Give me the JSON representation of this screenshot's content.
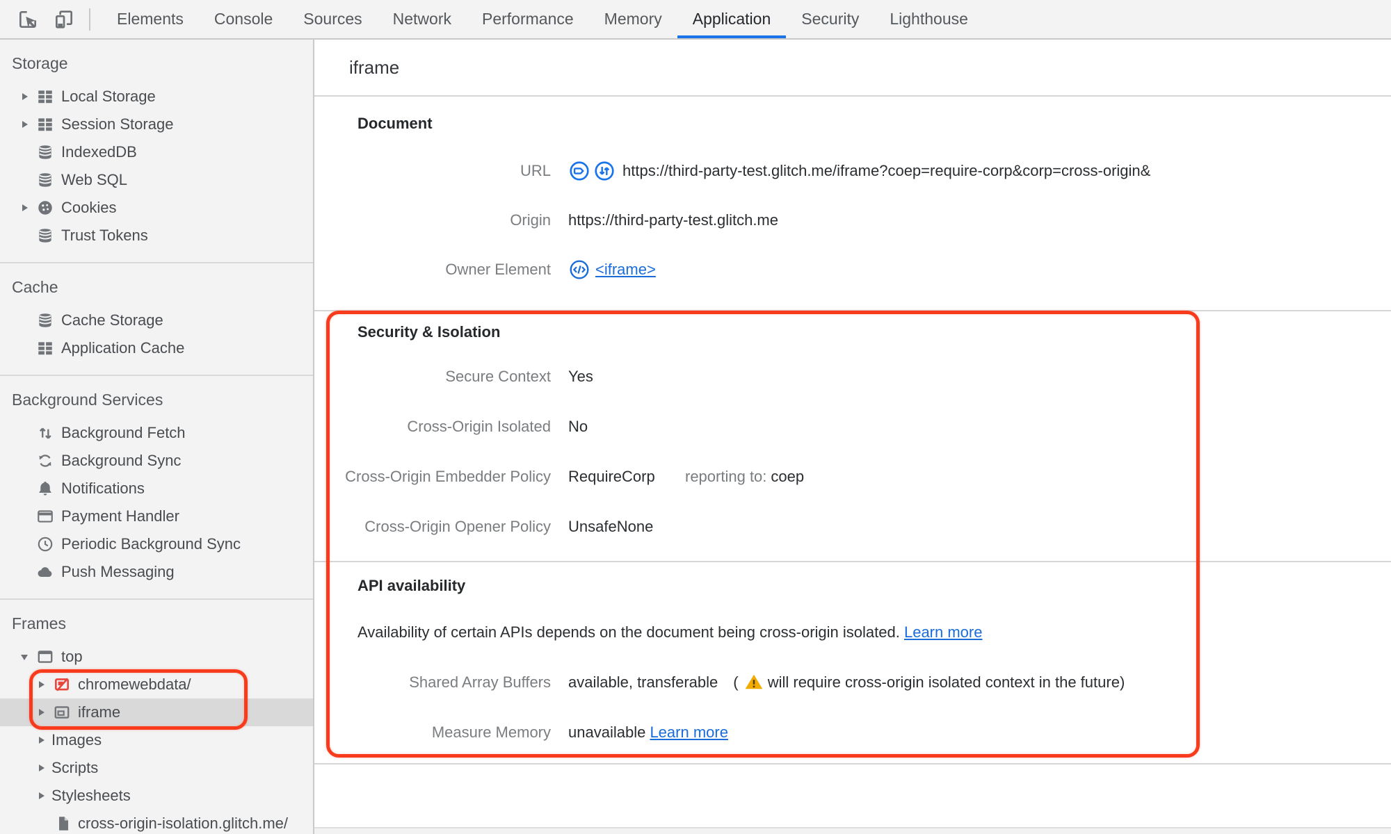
{
  "toolbar": {
    "tabs": [
      {
        "label": "Elements",
        "active": false
      },
      {
        "label": "Console",
        "active": false
      },
      {
        "label": "Sources",
        "active": false
      },
      {
        "label": "Network",
        "active": false
      },
      {
        "label": "Performance",
        "active": false
      },
      {
        "label": "Memory",
        "active": false
      },
      {
        "label": "Application",
        "active": true
      },
      {
        "label": "Security",
        "active": false
      },
      {
        "label": "Lighthouse",
        "active": false
      }
    ]
  },
  "sidebar": {
    "sections": {
      "storage": {
        "title": "Storage",
        "items": [
          "Local Storage",
          "Session Storage",
          "IndexedDB",
          "Web SQL",
          "Cookies",
          "Trust Tokens"
        ]
      },
      "cache": {
        "title": "Cache",
        "items": [
          "Cache Storage",
          "Application Cache"
        ]
      },
      "background": {
        "title": "Background Services",
        "items": [
          "Background Fetch",
          "Background Sync",
          "Notifications",
          "Payment Handler",
          "Periodic Background Sync",
          "Push Messaging"
        ]
      },
      "frames": {
        "title": "Frames",
        "root": "top",
        "children": [
          "chromewebdata/",
          "iframe"
        ],
        "siblings": [
          "Images",
          "Scripts",
          "Stylesheets"
        ],
        "file": "cross-origin-isolation.glitch.me/"
      }
    }
  },
  "main": {
    "title": "iframe",
    "document": {
      "heading": "Document",
      "url_label": "URL",
      "url_value": "https://third-party-test.glitch.me/iframe?coep=require-corp&corp=cross-origin&",
      "origin_label": "Origin",
      "origin_value": "https://third-party-test.glitch.me",
      "owner_label": "Owner Element",
      "owner_value": "<iframe>"
    },
    "security": {
      "heading": "Security & Isolation",
      "secure_context_label": "Secure Context",
      "secure_context_value": "Yes",
      "coi_label": "Cross-Origin Isolated",
      "coi_value": "No",
      "coep_label": "Cross-Origin Embedder Policy",
      "coep_value": "RequireCorp",
      "coep_reporting_label": "reporting to:",
      "coep_reporting_value": "coep",
      "coop_label": "Cross-Origin Opener Policy",
      "coop_value": "UnsafeNone"
    },
    "api": {
      "heading": "API availability",
      "intro": "Availability of certain APIs depends on the document being cross-origin isolated.",
      "intro_link": "Learn more",
      "sab_label": "Shared Array Buffers",
      "sab_value": "available, transferable",
      "sab_paren_open": "(",
      "sab_warning": "will require cross-origin isolated context in the future)",
      "mm_label": "Measure Memory",
      "mm_value": "unavailable",
      "mm_link": "Learn more"
    }
  },
  "colors": {
    "accent_blue": "#1a73e8",
    "link_blue": "#1a6dd9",
    "annotation_red": "#f93b1d",
    "warning_yellow": "#f2ab00",
    "selected_row_gray": "#d9d9d9",
    "toolbar_bg": "#f3f3f3"
  }
}
